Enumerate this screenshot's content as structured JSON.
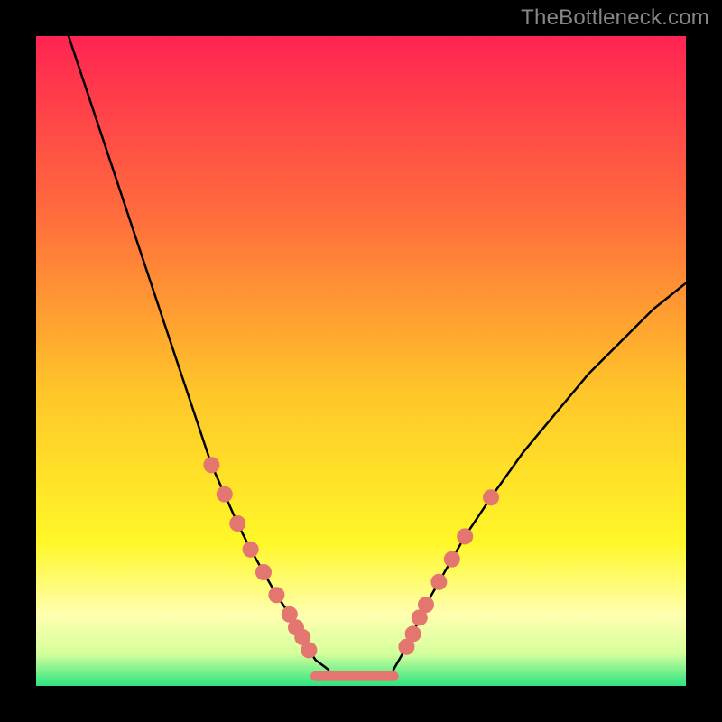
{
  "watermark": "TheBottleneck.com",
  "colors": {
    "gradient_top": "#FF2452",
    "gradient_mid1": "#FF6E3C",
    "gradient_mid2": "#FFC629",
    "gradient_mid3": "#FFF728",
    "gradient_mid4": "#FFFFB0",
    "gradient_mid5": "#D6FF9C",
    "gradient_bottom": "#2DE480",
    "curve": "#000000",
    "marker": "#E3766E",
    "frame": "#000000"
  },
  "chart_data": {
    "type": "line",
    "title": "",
    "xlabel": "",
    "ylabel": "",
    "xlim": [
      0,
      100
    ],
    "ylim": [
      0,
      100
    ],
    "series": [
      {
        "name": "left-curve",
        "x": [
          5,
          10,
          15,
          20,
          25,
          27,
          29,
          31,
          33,
          35,
          37,
          39,
          40,
          41,
          42,
          43,
          45
        ],
        "values": [
          100,
          85,
          70,
          55,
          40,
          34,
          29.5,
          25,
          21,
          17.5,
          14,
          11,
          9,
          7.5,
          5.5,
          4,
          2.5
        ]
      },
      {
        "name": "right-curve",
        "x": [
          55,
          57,
          58,
          59,
          60,
          62,
          64,
          66,
          70,
          75,
          80,
          85,
          90,
          95,
          100
        ],
        "values": [
          2.5,
          6,
          8,
          10.5,
          12.5,
          16,
          19.5,
          23,
          29,
          36,
          42,
          48,
          53,
          58,
          62
        ]
      },
      {
        "name": "flat-minimum",
        "x": [
          43,
          55
        ],
        "values": [
          1.5,
          1.5
        ]
      }
    ],
    "markers": [
      {
        "series": "left-curve",
        "x": 27,
        "y": 34
      },
      {
        "series": "left-curve",
        "x": 29,
        "y": 29.5
      },
      {
        "series": "left-curve",
        "x": 31,
        "y": 25
      },
      {
        "series": "left-curve",
        "x": 33,
        "y": 21
      },
      {
        "series": "left-curve",
        "x": 35,
        "y": 17.5
      },
      {
        "series": "left-curve",
        "x": 37,
        "y": 14
      },
      {
        "series": "left-curve",
        "x": 39,
        "y": 11
      },
      {
        "series": "left-curve",
        "x": 40,
        "y": 9
      },
      {
        "series": "left-curve",
        "x": 41,
        "y": 7.5
      },
      {
        "series": "left-curve",
        "x": 42,
        "y": 5.5
      },
      {
        "series": "right-curve",
        "x": 57,
        "y": 6
      },
      {
        "series": "right-curve",
        "x": 58,
        "y": 8
      },
      {
        "series": "right-curve",
        "x": 59,
        "y": 10.5
      },
      {
        "series": "right-curve",
        "x": 60,
        "y": 12.5
      },
      {
        "series": "right-curve",
        "x": 62,
        "y": 16
      },
      {
        "series": "right-curve",
        "x": 64,
        "y": 19.5
      },
      {
        "series": "right-curve",
        "x": 66,
        "y": 23
      },
      {
        "series": "right-curve",
        "x": 70,
        "y": 29
      }
    ]
  }
}
